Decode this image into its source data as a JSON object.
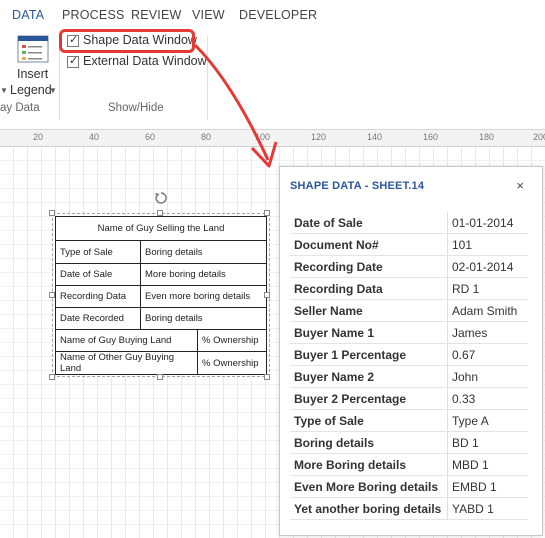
{
  "ribbon": {
    "tabs": [
      {
        "label": "DATA",
        "active": true
      },
      {
        "label": "PROCESS",
        "active": false
      },
      {
        "label": "REVIEW",
        "active": false
      },
      {
        "label": "VIEW",
        "active": false
      },
      {
        "label": "DEVELOPER",
        "active": false
      }
    ],
    "insert_legend": {
      "line1": "Insert",
      "line2": "Legend"
    },
    "group_display_data_label": "ay Data",
    "group_show_hide_label": "Show/Hide",
    "checkboxes": [
      {
        "label": "Shape Data Window",
        "checked": true
      },
      {
        "label": "External Data Window",
        "checked": true
      }
    ]
  },
  "ruler": {
    "ticks": [
      "20",
      "40",
      "60",
      "80",
      "100",
      "120",
      "140",
      "160",
      "180",
      "200"
    ]
  },
  "shape_table": {
    "header": "Name of Guy Selling the Land",
    "rows": [
      {
        "label": "Type of Sale",
        "value": "Boring details"
      },
      {
        "label": "Date of Sale",
        "value": "More boring details"
      },
      {
        "label": "Recording Data",
        "value": "Even more boring details"
      },
      {
        "label": "Date Recorded",
        "value": "Boring details"
      }
    ],
    "buyers": [
      {
        "label": "Name of Guy Buying Land",
        "value": "% Ownership"
      },
      {
        "label": "Name of Other Guy Buying Land",
        "value": "% Ownership"
      }
    ]
  },
  "shape_data_window": {
    "title": "SHAPE DATA - SHEET.14",
    "close_glyph": "×",
    "rows": [
      {
        "key": "Date of Sale",
        "value": "01-01-2014"
      },
      {
        "key": "Document No#",
        "value": "101"
      },
      {
        "key": "Recording Date",
        "value": "02-01-2014"
      },
      {
        "key": "Recording Data",
        "value": "RD 1"
      },
      {
        "key": "Seller Name",
        "value": "Adam Smith"
      },
      {
        "key": "Buyer Name 1",
        "value": "James"
      },
      {
        "key": "Buyer 1 Percentage",
        "value": "0.67"
      },
      {
        "key": "Buyer Name 2",
        "value": "John"
      },
      {
        "key": "Buyer 2 Percentage",
        "value": "0.33"
      },
      {
        "key": "Type of Sale",
        "value": "Type A"
      },
      {
        "key": "Boring details",
        "value": "BD 1"
      },
      {
        "key": "More Boring details",
        "value": "MBD 1"
      },
      {
        "key": "Even More Boring details",
        "value": "EMBD 1"
      },
      {
        "key": "Yet another boring details",
        "value": "YABD 1"
      }
    ]
  },
  "colors": {
    "accent": "#2b579a",
    "annotation_red": "#e53935"
  }
}
